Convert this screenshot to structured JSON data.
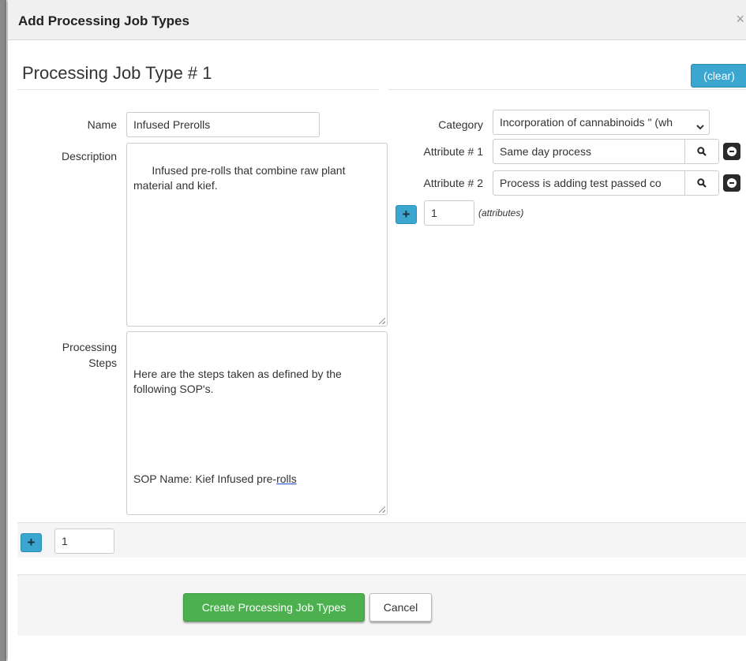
{
  "modal": {
    "title": "Add Processing Job Types",
    "close_label": "×"
  },
  "section": {
    "title": "Processing Job Type # 1",
    "clear_label": "(clear)"
  },
  "fields": {
    "name_label": "Name",
    "name_value": "Infused Prerolls",
    "description_label": "Description",
    "description_value": "Infused pre-rolls that combine raw plant material and kief.",
    "steps_label_line1": "Processing",
    "steps_label_line2": "Steps",
    "steps_line1": "Here are the steps taken as defined by the following SOP's.",
    "steps_line2": "SOP Name: Kief Infused pre-",
    "steps_link": "rolls"
  },
  "right": {
    "category_label": "Category",
    "category_value": "Incorporation of cannabinoids \" (wh",
    "attributes": [
      {
        "label": "Attribute # 1",
        "value": "Same day process"
      },
      {
        "label": "Attribute # 2",
        "value": "Process is adding test passed co"
      }
    ],
    "add_count": "1",
    "add_hint": "(attributes)"
  },
  "bottom": {
    "add_count": "1"
  },
  "footer": {
    "create_label": "Create Processing Job Types",
    "cancel_label": "Cancel"
  },
  "icons": {
    "search": "search-icon",
    "remove": "minus-circle-icon",
    "add": "plus-icon",
    "dropdown": "chevron-down-icon"
  },
  "colors": {
    "accent_blue": "#3ba6d0",
    "success_green": "#4cb04f"
  }
}
